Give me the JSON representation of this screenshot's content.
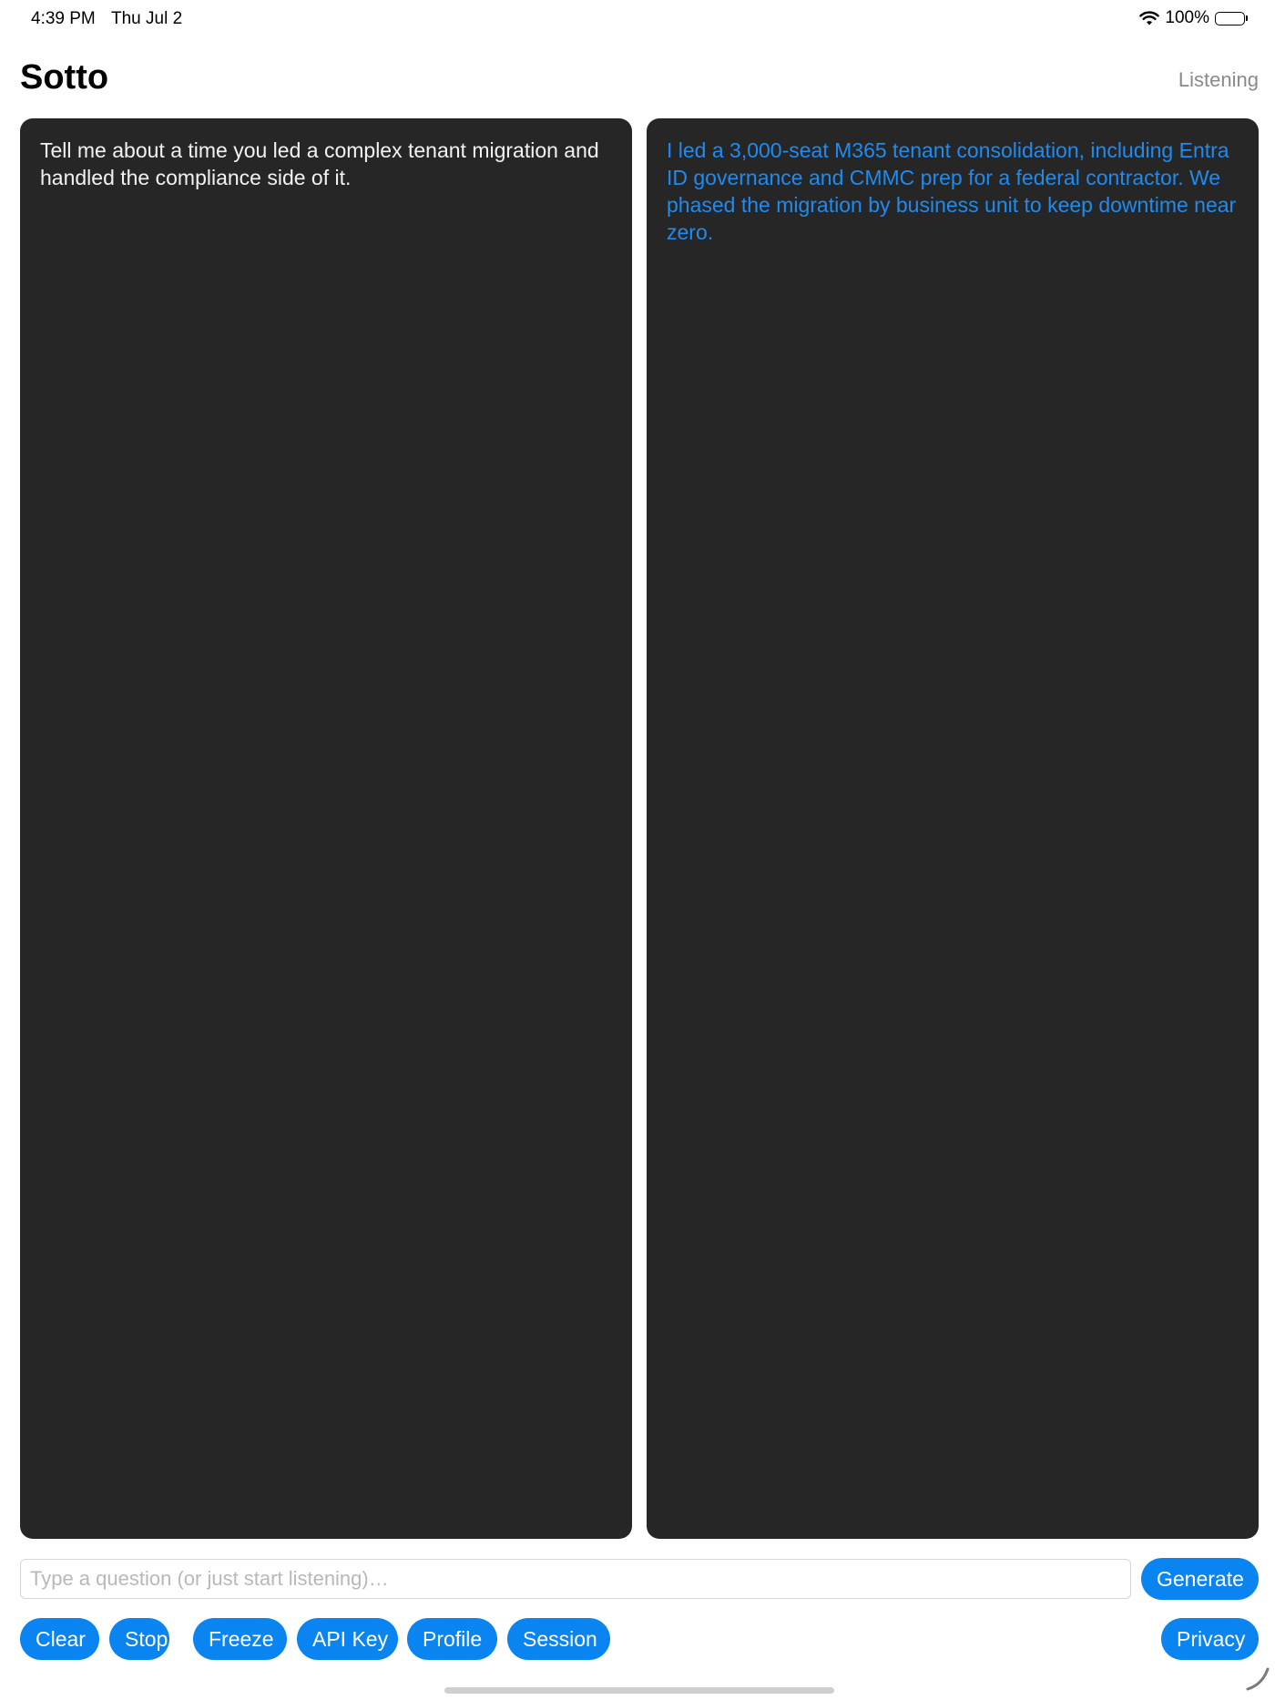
{
  "status_bar": {
    "time": "4:39 PM",
    "date": "Thu Jul 2",
    "battery": "100%",
    "icons": [
      "wifi-icon",
      "battery-icon"
    ]
  },
  "header": {
    "title": "Sotto",
    "status": "Listening"
  },
  "panels": {
    "question": "Tell me about a time you led a complex tenant migration and handled the compliance side of it.",
    "answer": "I led a 3,000-seat M365 tenant consolidation, including Entra ID governance and CMMC prep for a federal contractor. We phased the migration by business unit to keep downtime near zero."
  },
  "input": {
    "value": "",
    "placeholder": "Type a question (or just start listening)…"
  },
  "buttons": {
    "generate": "Generate",
    "clear": "Clear",
    "stop": "Stop",
    "freeze": "Freeze",
    "api_key": "API Key",
    "profile": "Profile",
    "session": "Session",
    "privacy": "Privacy"
  },
  "colors": {
    "accent": "#0a84f0",
    "answer_text": "#1f8bf0",
    "panel_bg": "#262627",
    "question_text": "#f2f2f2",
    "status_text": "#8a8a8e"
  }
}
